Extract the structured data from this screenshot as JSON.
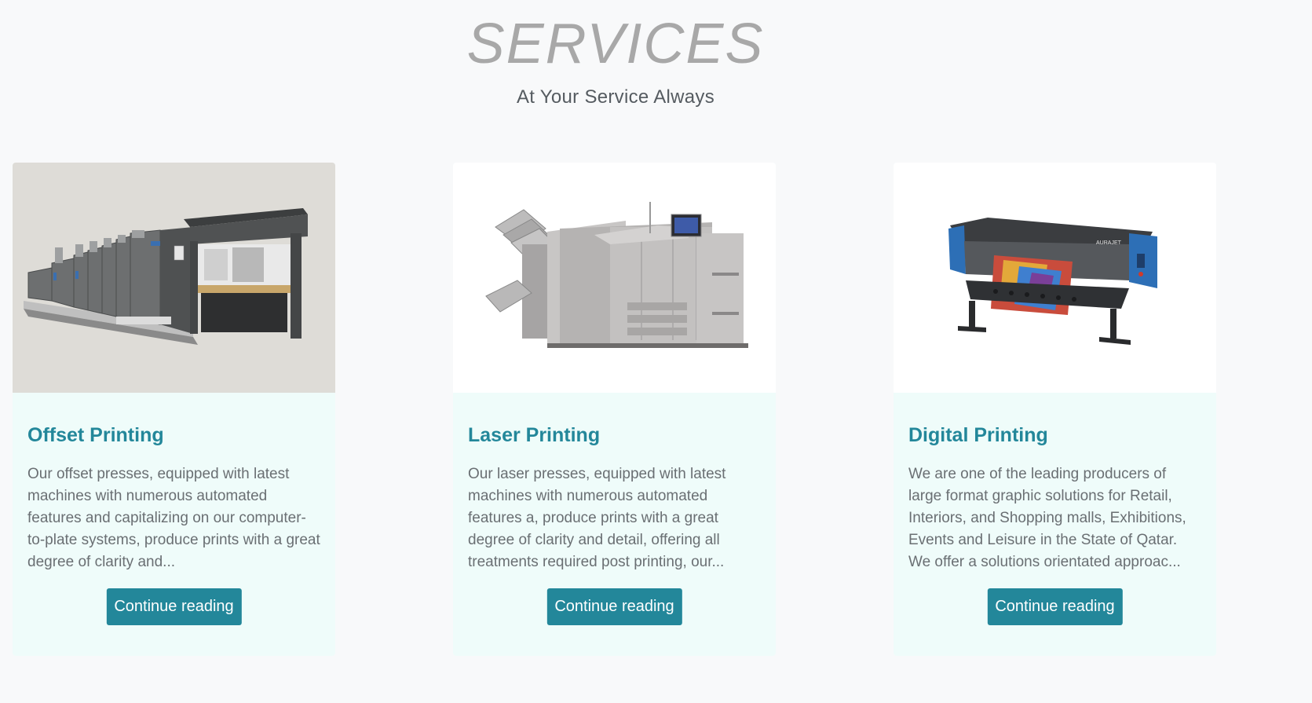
{
  "header": {
    "title": "SERVICES",
    "subtitle": "At Your Service Always"
  },
  "cards": [
    {
      "title": "Offset Printing",
      "text": "Our offset presses, equipped with latest machines with numerous automated features and capitalizing on our computer-to-plate systems, produce prints with a great degree of clarity and...",
      "button_label": "Continue reading",
      "image_icon": "offset-press-image"
    },
    {
      "title": "Laser Printing",
      "text": "Our laser presses, equipped with latest machines with numerous automated features a, produce prints with a great degree of clarity and detail, offering all treatments required post printing, our...",
      "button_label": "Continue reading",
      "image_icon": "laser-press-image"
    },
    {
      "title": "Digital Printing",
      "text": "We are one of the leading producers of large format graphic solutions for Retail, Interiors, and Shopping malls, Exhibitions, Events and Leisure in the State of Qatar. We offer a solutions orientated approac...",
      "button_label": "Continue reading",
      "image_icon": "large-format-printer-image",
      "printer_brand": "AURAJET"
    }
  ],
  "colors": {
    "accent": "#23879a",
    "card_background": "#effcfa",
    "page_background": "#f8f9fa"
  }
}
